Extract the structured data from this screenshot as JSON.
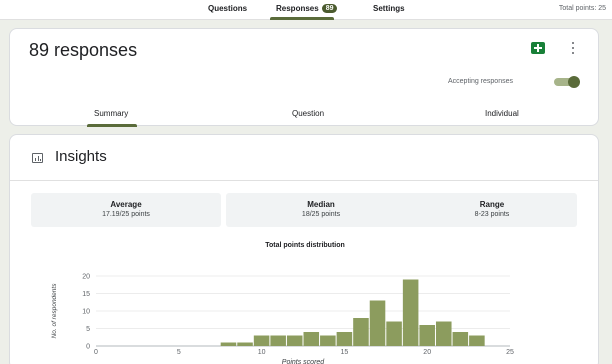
{
  "nav": {
    "tabs": [
      {
        "label": "Questions"
      },
      {
        "label": "Responses",
        "badge": "89"
      },
      {
        "label": "Settings"
      }
    ],
    "total_points": "Total points: 25"
  },
  "responses_card": {
    "title": "89 responses",
    "accepting_label": "Accepting responses",
    "accepting": true,
    "subtabs": [
      "Summary",
      "Question",
      "Individual"
    ],
    "active_subtab": "Summary"
  },
  "insights": {
    "title": "Insights",
    "stats": [
      {
        "label": "Average",
        "value": "17.19/25 points"
      },
      {
        "label": "Median",
        "value": "18/25 points"
      },
      {
        "label": "Range",
        "value": "8-23 points"
      }
    ]
  },
  "colors": {
    "accent": "#5a6b3a",
    "bar": "#8c9c5e",
    "sheets": "#188038"
  },
  "chart_data": {
    "type": "bar",
    "title": "Total points distribution",
    "xlabel": "Points scored",
    "ylabel": "No. of respondents",
    "x": [
      8,
      9,
      10,
      11,
      12,
      13,
      14,
      15,
      16,
      17,
      18,
      19,
      20,
      21,
      22,
      23
    ],
    "values": [
      1,
      1,
      3,
      3,
      3,
      4,
      3,
      4,
      8,
      13,
      7,
      19,
      6,
      7,
      4,
      3
    ],
    "xlim": [
      0,
      25
    ],
    "ylim": [
      0,
      20
    ],
    "xticks": [
      0,
      5,
      10,
      15,
      20,
      25
    ],
    "yticks": [
      0,
      5,
      10,
      15,
      20
    ],
    "grid": true
  }
}
